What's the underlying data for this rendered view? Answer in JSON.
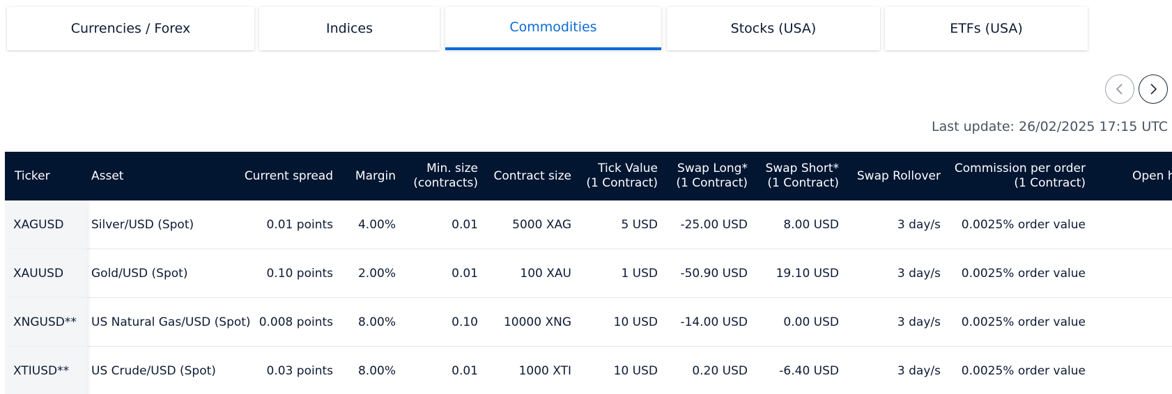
{
  "tabs": [
    {
      "label": "Currencies / Forex",
      "active": false
    },
    {
      "label": "Indices",
      "active": false
    },
    {
      "label": "Commodities",
      "active": true
    },
    {
      "label": "Stocks (USA)",
      "active": false
    },
    {
      "label": "ETFs (USA)",
      "active": false
    }
  ],
  "nav": {
    "prev_icon": "chevron-left-icon",
    "next_icon": "chevron-right-icon"
  },
  "last_update": "Last update: 26/02/2025 17:15 UTC",
  "colors": {
    "accent": "#0a6ad6",
    "header_bg": "#021632",
    "ticker_bg": "#f4f5f7"
  },
  "table": {
    "headers": {
      "ticker": "Ticker",
      "asset": "Asset",
      "spread": "Current spread",
      "margin": "Margin",
      "min_size_1": "Min. size",
      "min_size_2": "(contracts)",
      "contract_size": "Contract size",
      "tick_value_1": "Tick Value",
      "tick_value_2": "(1 Contract)",
      "swap_long_1": "Swap Long*",
      "swap_long_2": "(1 Contract)",
      "swap_short_1": "Swap Short*",
      "swap_short_2": "(1 Contract)",
      "swap_rollover": "Swap Rollover",
      "commission_1": "Commission per order",
      "commission_2": "(1 Contract)",
      "open": "Open h"
    },
    "rows": [
      {
        "ticker": "XAGUSD",
        "asset": "Silver/USD (Spot)",
        "spread": "0.01 points",
        "margin": "4.00%",
        "min_size": "0.01",
        "contract_size": "5000 XAG",
        "tick_value": "5 USD",
        "swap_long": "-25.00 USD",
        "swap_short": "8.00 USD",
        "swap_rollover": "3 day/s",
        "commission": "0.0025% order value"
      },
      {
        "ticker": "XAUUSD",
        "asset": "Gold/USD (Spot)",
        "spread": "0.10 points",
        "margin": "2.00%",
        "min_size": "0.01",
        "contract_size": "100 XAU",
        "tick_value": "1 USD",
        "swap_long": "-50.90 USD",
        "swap_short": "19.10 USD",
        "swap_rollover": "3 day/s",
        "commission": "0.0025% order value"
      },
      {
        "ticker": "XNGUSD**",
        "asset": "US Natural Gas/USD (Spot)",
        "spread": "0.008 points",
        "margin": "8.00%",
        "min_size": "0.10",
        "contract_size": "10000 XNG",
        "tick_value": "10 USD",
        "swap_long": "-14.00 USD",
        "swap_short": "0.00 USD",
        "swap_rollover": "3 day/s",
        "commission": "0.0025% order value"
      },
      {
        "ticker": "XTIUSD**",
        "asset": "US Crude/USD (Spot)",
        "spread": "0.03 points",
        "margin": "8.00%",
        "min_size": "0.01",
        "contract_size": "1000 XTI",
        "tick_value": "10 USD",
        "swap_long": "0.20 USD",
        "swap_short": "-6.40 USD",
        "swap_rollover": "3 day/s",
        "commission": "0.0025% order value"
      }
    ]
  }
}
